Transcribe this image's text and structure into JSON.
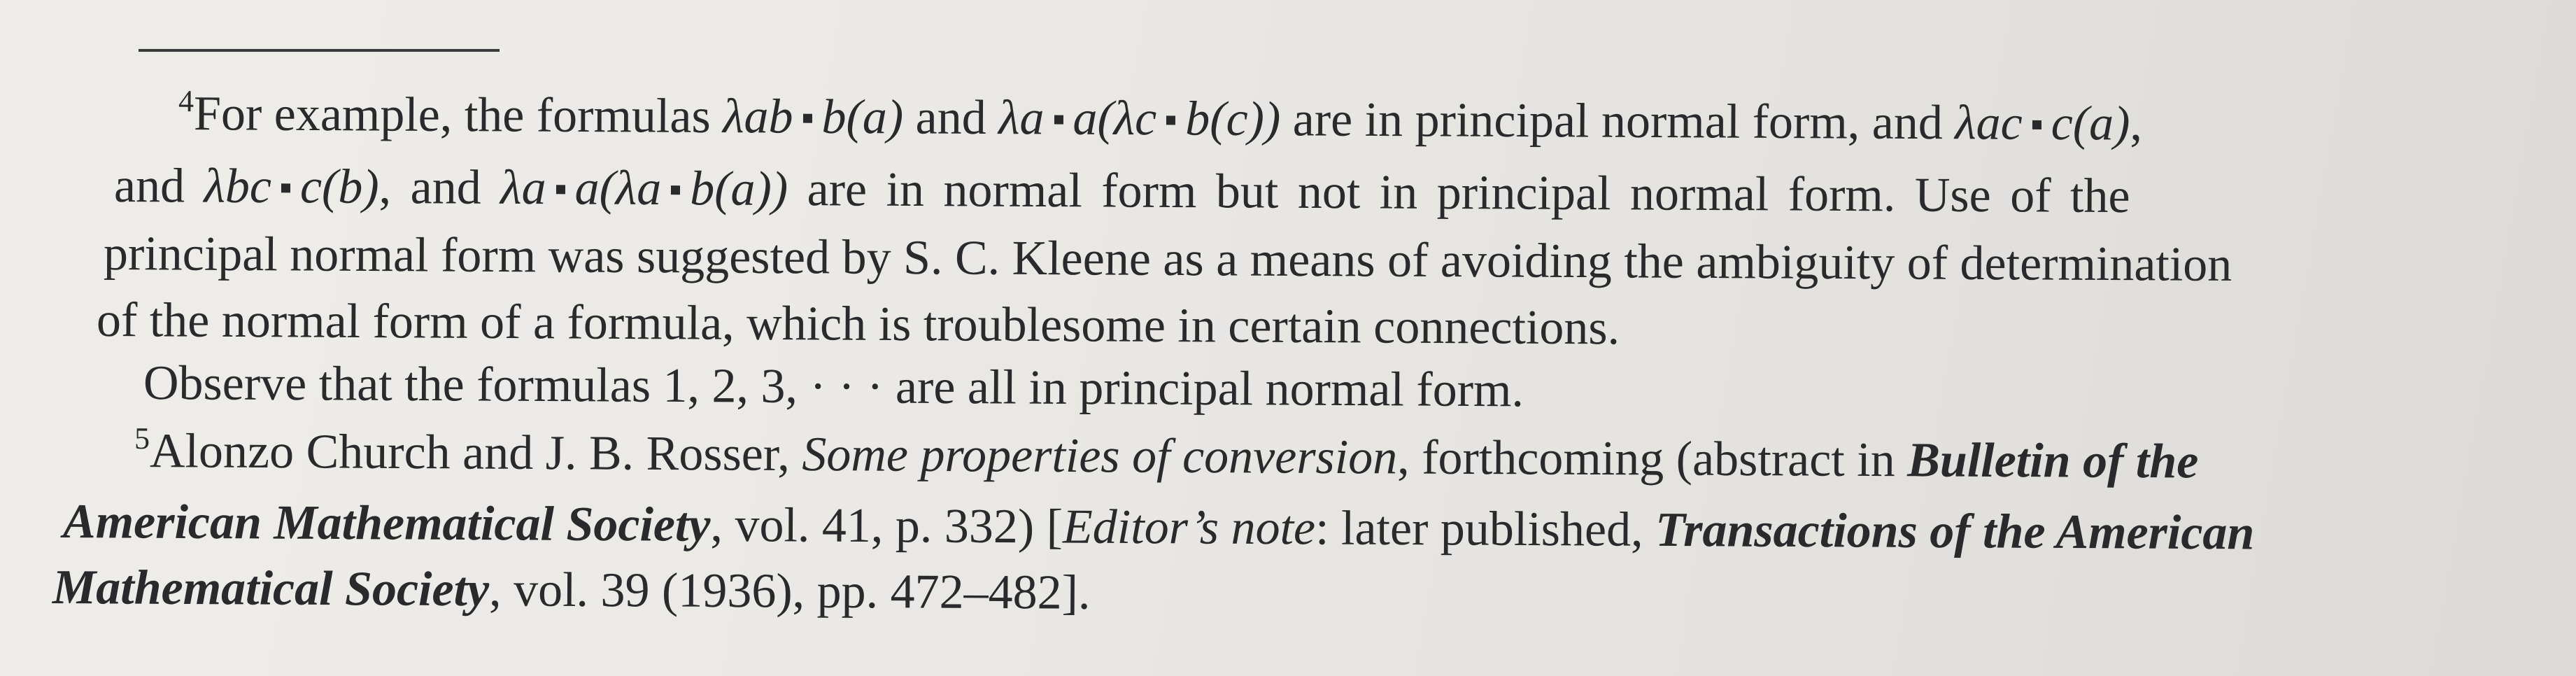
{
  "footnotes": {
    "fn4": {
      "marker": "4",
      "l1_a": "For example, the formulas ",
      "l1_f1a": "λab",
      "l1_f1b": "b(a)",
      "l1_b": " and ",
      "l1_f2a": "λa",
      "l1_f2b": "a(λc",
      "l1_f2c": "b(c))",
      "l1_c": " are in principal normal form, and ",
      "l1_f3a": "λac",
      "l1_f3b": "c(a)",
      "l1_d": ",",
      "l2_a": "and ",
      "l2_f1a": "λbc",
      "l2_f1b": "c(b)",
      "l2_b": ", and ",
      "l2_f2a": "λa",
      "l2_f2b": "a(λa",
      "l2_f2c": "b(a))",
      "l2_c": " are in normal form but not in principal normal form.  Use of the",
      "l3": "principal normal form was suggested by S. C. Kleene as a means of avoiding the ambiguity of determination",
      "l4": "of the normal form of a formula, which is troublesome in certain connections.",
      "l5": "Observe that the formulas 1, 2, 3, · · ·  are all in principal normal form."
    },
    "fn5": {
      "marker": "5",
      "l1_a": "Alonzo Church and J. B. Rosser, ",
      "l1_title": "Some properties of conversion",
      "l1_b": ", forthcoming (abstract in ",
      "l1_journal": "Bulletin of the",
      "l2_journal": "American Mathematical Society",
      "l2_a": ", vol. 41, p. 332) [",
      "l2_note": "Editor’s note",
      "l2_b": ": later published, ",
      "l2_journal2": "Transactions of the American",
      "l3_journal2": "Mathematical Society",
      "l3_a": ", vol. 39 (1936), pp. 472–482]."
    }
  }
}
